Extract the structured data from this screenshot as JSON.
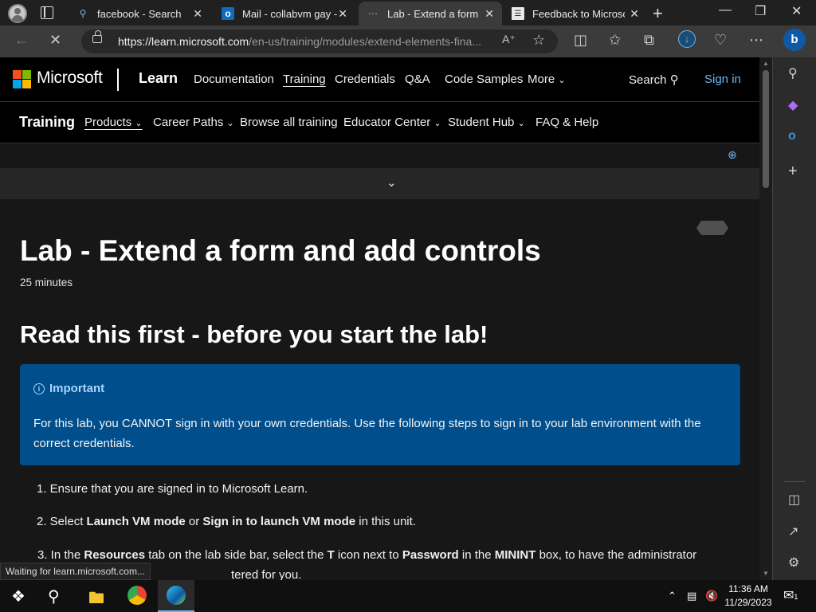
{
  "browser": {
    "tabs": [
      {
        "label": "facebook - Search",
        "icon": "search-icon",
        "active": false
      },
      {
        "label": "Mail - collabvm gay -",
        "icon": "outlook-icon",
        "active": false
      },
      {
        "label": "Lab - Extend a form an",
        "icon": "loading-icon",
        "active": true
      },
      {
        "label": "Feedback to Microsoft",
        "icon": "document-icon",
        "active": false
      }
    ],
    "url_host": "https://learn.microsoft.com",
    "url_path": "/en-us/training/modules/extend-elements-fina...",
    "status_text": "Waiting for learn.microsoft.com..."
  },
  "header": {
    "brand": "Microsoft",
    "product": "Learn",
    "nav": [
      "Documentation",
      "Training",
      "Credentials",
      "Q&A",
      "Code Samples",
      "More"
    ],
    "search": "Search",
    "signin": "Sign in"
  },
  "subnav": {
    "title": "Training",
    "links": [
      "Products",
      "Career Paths",
      "Browse all training",
      "Educator Center",
      "Student Hub",
      "FAQ & Help"
    ]
  },
  "article": {
    "title": "Lab - Extend a form and add controls",
    "duration": "25 minutes",
    "heading": "Read this first - before you start the lab!",
    "alert_title": "Important",
    "alert_body": "For this lab, you CANNOT sign in with your own credentials. Use the following steps to sign in to your lab environment with the correct credentials.",
    "steps": {
      "s1": "1. Ensure that you are signed in to Microsoft Learn.",
      "s2_a": "2. Select ",
      "s2_b": "Launch VM mode",
      "s2_c": " or ",
      "s2_d": "Sign in to launch VM mode",
      "s2_e": " in this unit.",
      "s3_a": "3. In the ",
      "s3_b": "Resources",
      "s3_c": " tab on the lab side bar, select the ",
      "s3_d": "T",
      "s3_e": " icon next to ",
      "s3_f": "Password",
      "s3_g": " in the ",
      "s3_h": "MININT",
      "s3_i": " box, to have the administrator",
      "s3_line2": "tered for you."
    }
  },
  "taskbar": {
    "time": "11:36 AM",
    "date": "11/29/2023",
    "notifications": "1"
  },
  "colors": {
    "alert_bg": "#004e8c",
    "link_blue": "#6cb8f6",
    "ms_red": "#f25022",
    "ms_green": "#7fba00",
    "ms_blue": "#00a4ef",
    "ms_yellow": "#ffb900"
  }
}
